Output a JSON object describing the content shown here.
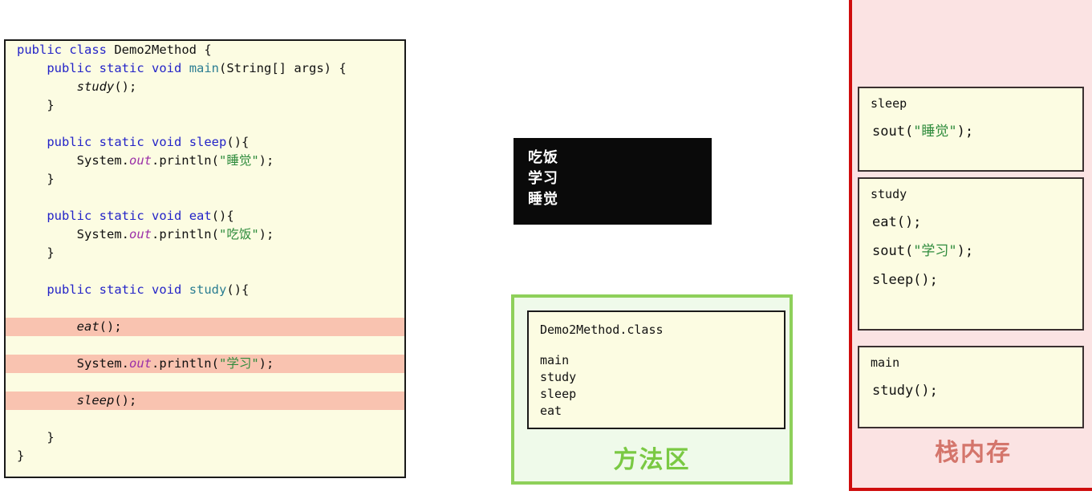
{
  "code_panel": {
    "lines": [
      {
        "highlight": false,
        "tokens": [
          {
            "t": "public",
            "c": "kw"
          },
          {
            "t": " ",
            "c": "plain"
          },
          {
            "t": "class",
            "c": "kw"
          },
          {
            "t": " Demo2Method {",
            "c": "plain"
          }
        ]
      },
      {
        "highlight": false,
        "tokens": [
          {
            "t": "    ",
            "c": "plain"
          },
          {
            "t": "public",
            "c": "kw"
          },
          {
            "t": " ",
            "c": "plain"
          },
          {
            "t": "static",
            "c": "kw"
          },
          {
            "t": " ",
            "c": "plain"
          },
          {
            "t": "void",
            "c": "kw"
          },
          {
            "t": " ",
            "c": "plain"
          },
          {
            "t": "main",
            "c": "mth"
          },
          {
            "t": "(String[] args) {",
            "c": "plain"
          }
        ]
      },
      {
        "highlight": false,
        "tokens": [
          {
            "t": "        ",
            "c": "plain"
          },
          {
            "t": "study",
            "c": "call"
          },
          {
            "t": "();",
            "c": "plain"
          }
        ]
      },
      {
        "highlight": false,
        "tokens": [
          {
            "t": "    }",
            "c": "plain"
          }
        ]
      },
      {
        "highlight": false,
        "tokens": [
          {
            "t": " ",
            "c": "plain"
          }
        ]
      },
      {
        "highlight": false,
        "tokens": [
          {
            "t": "    ",
            "c": "plain"
          },
          {
            "t": "public",
            "c": "kw"
          },
          {
            "t": " ",
            "c": "plain"
          },
          {
            "t": "static",
            "c": "kw"
          },
          {
            "t": " ",
            "c": "plain"
          },
          {
            "t": "void",
            "c": "kw"
          },
          {
            "t": " ",
            "c": "plain"
          },
          {
            "t": "sleep",
            "c": "kw"
          },
          {
            "t": "(){",
            "c": "plain"
          }
        ]
      },
      {
        "highlight": false,
        "tokens": [
          {
            "t": "        System.",
            "c": "plain"
          },
          {
            "t": "out",
            "c": "fld"
          },
          {
            "t": ".println(",
            "c": "plain"
          },
          {
            "t": "\"睡觉\"",
            "c": "str"
          },
          {
            "t": ");",
            "c": "plain"
          }
        ]
      },
      {
        "highlight": false,
        "tokens": [
          {
            "t": "    }",
            "c": "plain"
          }
        ]
      },
      {
        "highlight": false,
        "tokens": [
          {
            "t": " ",
            "c": "plain"
          }
        ]
      },
      {
        "highlight": false,
        "tokens": [
          {
            "t": "    ",
            "c": "plain"
          },
          {
            "t": "public",
            "c": "kw"
          },
          {
            "t": " ",
            "c": "plain"
          },
          {
            "t": "static",
            "c": "kw"
          },
          {
            "t": " ",
            "c": "plain"
          },
          {
            "t": "void",
            "c": "kw"
          },
          {
            "t": " ",
            "c": "plain"
          },
          {
            "t": "eat",
            "c": "kw"
          },
          {
            "t": "(){",
            "c": "plain"
          }
        ]
      },
      {
        "highlight": false,
        "tokens": [
          {
            "t": "        System.",
            "c": "plain"
          },
          {
            "t": "out",
            "c": "fld"
          },
          {
            "t": ".println(",
            "c": "plain"
          },
          {
            "t": "\"吃饭\"",
            "c": "str"
          },
          {
            "t": ");",
            "c": "plain"
          }
        ]
      },
      {
        "highlight": false,
        "tokens": [
          {
            "t": "    }",
            "c": "plain"
          }
        ]
      },
      {
        "highlight": false,
        "tokens": [
          {
            "t": " ",
            "c": "plain"
          }
        ]
      },
      {
        "highlight": false,
        "tokens": [
          {
            "t": "    ",
            "c": "plain"
          },
          {
            "t": "public",
            "c": "kw"
          },
          {
            "t": " ",
            "c": "plain"
          },
          {
            "t": "static",
            "c": "kw"
          },
          {
            "t": " ",
            "c": "plain"
          },
          {
            "t": "void",
            "c": "kw"
          },
          {
            "t": " ",
            "c": "plain"
          },
          {
            "t": "study",
            "c": "mth"
          },
          {
            "t": "(){",
            "c": "plain"
          }
        ]
      },
      {
        "highlight": false,
        "tokens": [
          {
            "t": " ",
            "c": "plain"
          }
        ]
      },
      {
        "highlight": true,
        "tokens": [
          {
            "t": "        ",
            "c": "plain"
          },
          {
            "t": "eat",
            "c": "call"
          },
          {
            "t": "();",
            "c": "plain"
          }
        ]
      },
      {
        "highlight": false,
        "tokens": [
          {
            "t": " ",
            "c": "plain"
          }
        ]
      },
      {
        "highlight": true,
        "tokens": [
          {
            "t": "        System.",
            "c": "plain"
          },
          {
            "t": "out",
            "c": "fld"
          },
          {
            "t": ".println(",
            "c": "plain"
          },
          {
            "t": "\"学习\"",
            "c": "str"
          },
          {
            "t": ");",
            "c": "plain"
          }
        ]
      },
      {
        "highlight": false,
        "tokens": [
          {
            "t": " ",
            "c": "plain"
          }
        ]
      },
      {
        "highlight": true,
        "tokens": [
          {
            "t": "        ",
            "c": "plain"
          },
          {
            "t": "sleep",
            "c": "call"
          },
          {
            "t": "();",
            "c": "plain"
          }
        ]
      },
      {
        "highlight": false,
        "tokens": [
          {
            "t": " ",
            "c": "plain"
          }
        ]
      },
      {
        "highlight": false,
        "tokens": [
          {
            "t": "    }",
            "c": "plain"
          }
        ]
      },
      {
        "highlight": false,
        "tokens": [
          {
            "t": "}",
            "c": "plain"
          }
        ]
      }
    ]
  },
  "console": {
    "lines": [
      "吃饭",
      "学习",
      "睡觉"
    ]
  },
  "method_area": {
    "class_file": "Demo2Method.class",
    "methods": [
      "main",
      "study",
      "sleep",
      "eat"
    ],
    "label": "方法区",
    "accent_color": "#7ac943"
  },
  "stack": {
    "label": "栈内存",
    "accent_color": "#cf0d0d",
    "frames": [
      {
        "name": "sleep",
        "statements": [
          {
            "segments": [
              {
                "t": "sout(",
                "c": "plain"
              },
              {
                "t": "\"睡觉\"",
                "c": "str"
              },
              {
                "t": ");",
                "c": "plain"
              }
            ]
          }
        ]
      },
      {
        "name": "study",
        "statements": [
          {
            "segments": [
              {
                "t": "eat();",
                "c": "plain"
              }
            ]
          },
          {
            "segments": [
              {
                "t": "sout(",
                "c": "plain"
              },
              {
                "t": "\"学习\"",
                "c": "str"
              },
              {
                "t": ");",
                "c": "plain"
              }
            ]
          },
          {
            "segments": [
              {
                "t": "sleep();",
                "c": "plain"
              }
            ]
          }
        ]
      },
      {
        "name": "main",
        "statements": [
          {
            "segments": [
              {
                "t": "study();",
                "c": "plain"
              }
            ]
          }
        ]
      }
    ]
  }
}
